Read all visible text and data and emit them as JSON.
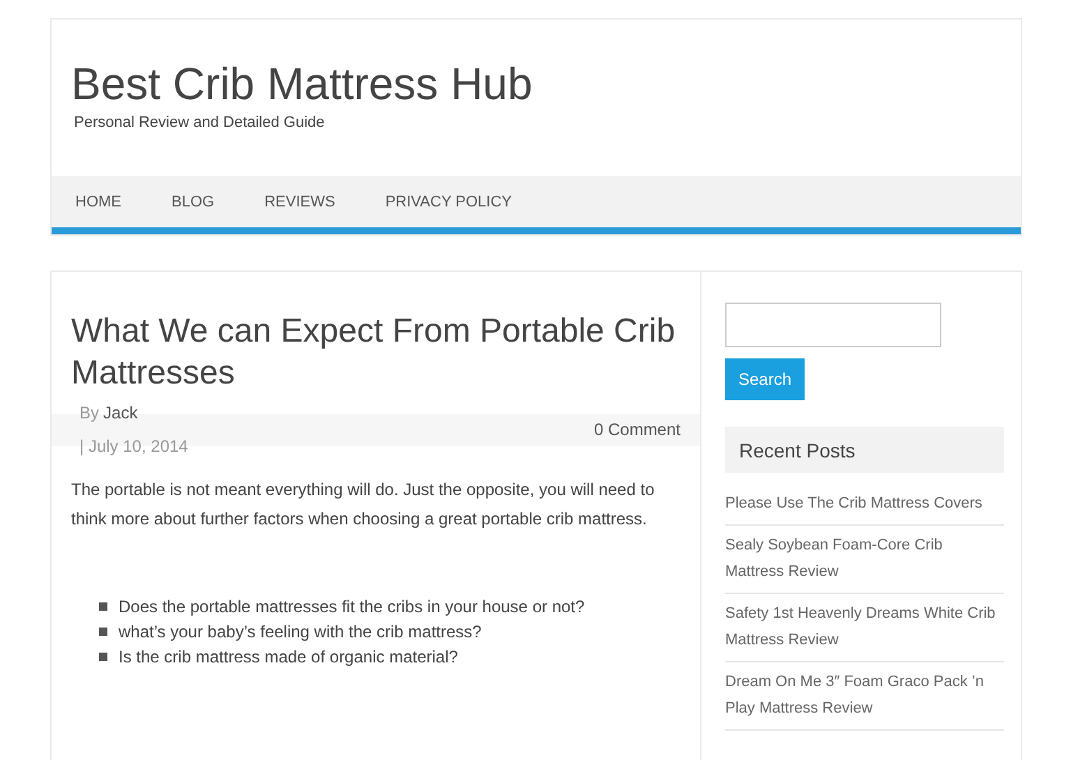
{
  "site": {
    "title": "Best Crib Mattress Hub",
    "tagline": "Personal Review and Detailed Guide"
  },
  "nav": [
    {
      "label": "HOME"
    },
    {
      "label": "BLOG"
    },
    {
      "label": "REVIEWS"
    },
    {
      "label": "PRIVACY POLICY"
    }
  ],
  "article": {
    "title": "What We can Expect From Portable Crib Mattresses",
    "by": "By",
    "author": "Jack",
    "date": "| July 10, 2014",
    "comments": "0 Comment",
    "intro": "The portable is not meant everything will do. Just the opposite, you will need to think more about further factors when choosing a great portable crib mattress.",
    "bullets": [
      "Does the portable mattresses fit the cribs in your house or not?",
      "what’s your baby’s feeling with the crib mattress?",
      "Is the crib mattress made of organic material?"
    ]
  },
  "sidebar": {
    "search_button": "Search",
    "recent_title": "Recent Posts",
    "posts": [
      "Please Use The Crib Mattress Covers",
      "Sealy Soybean Foam-Core Crib Mattress Review",
      "Safety 1st Heavenly Dreams White Crib Mattress Review",
      "Dream On Me 3″ Foam Graco Pack ’n Play Mattress Review"
    ]
  }
}
